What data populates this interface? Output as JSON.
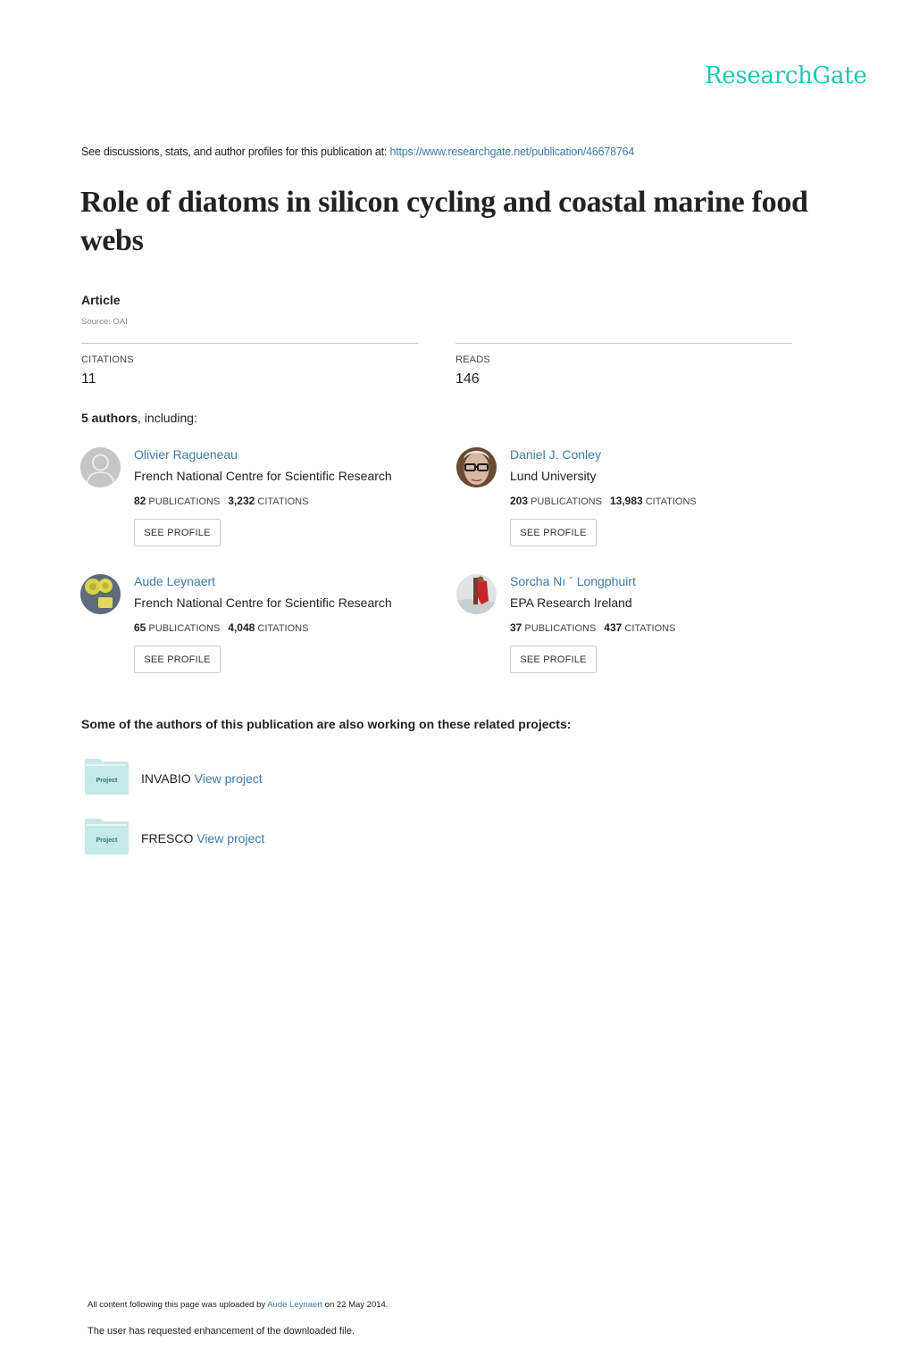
{
  "header": {
    "logo": "ResearchGate",
    "intro_text": "See discussions, stats, and author profiles for this publication at: ",
    "publication_url": "https://www.researchgate.net/publication/46678764"
  },
  "publication": {
    "title": "Role of diatoms in silicon cycling and coastal marine food webs",
    "type": "Article",
    "source": "Source: OAI"
  },
  "stats": {
    "citations_label": "CITATIONS",
    "citations_value": "11",
    "reads_label": "READS",
    "reads_value": "146"
  },
  "authors_summary": {
    "count_text": "5 authors",
    "suffix": ", including:"
  },
  "authors": [
    {
      "name": "Olivier Ragueneau",
      "institution": "French National Centre for Scientific Research",
      "publications": "82",
      "publications_label": "PUBLICATIONS",
      "citations": "3,232",
      "citations_label": "CITATIONS",
      "button": "SEE PROFILE",
      "avatar": "default-avatar"
    },
    {
      "name": "Daniel J. Conley",
      "institution": "Lund University",
      "publications": "203",
      "publications_label": "PUBLICATIONS",
      "citations": "13,983",
      "citations_label": "CITATIONS",
      "button": "SEE PROFILE",
      "avatar": "photo-man-glasses"
    },
    {
      "name": "Aude Leynaert",
      "institution": "French National Centre for Scientific Research",
      "publications": "65",
      "publications_label": "PUBLICATIONS",
      "citations": "4,048",
      "citations_label": "CITATIONS",
      "button": "SEE PROFILE",
      "avatar": "photo-diatoms"
    },
    {
      "name": "Sorcha Nı ´ Longphuirt",
      "institution": "EPA Research Ireland",
      "publications": "37",
      "publications_label": "PUBLICATIONS",
      "citations": "437",
      "citations_label": "CITATIONS",
      "button": "SEE PROFILE",
      "avatar": "photo-field-work"
    }
  ],
  "related": {
    "heading": "Some of the authors of this publication are also working on these related projects:",
    "projects": [
      {
        "icon_label": "Project",
        "name": "INVABIO",
        "link": "View project"
      },
      {
        "icon_label": "Project",
        "name": "FRESCO",
        "link": "View project"
      }
    ]
  },
  "footer": {
    "upload_prefix": "All content following this page was uploaded by ",
    "uploader": "Aude Leynaert",
    "upload_suffix": " on 22 May 2014.",
    "enhancement_note": "The user has requested enhancement of the downloaded file."
  },
  "colors": {
    "brand": "#1fc8b0",
    "link": "#3d7bab",
    "project_folder": "#c5e9e6"
  }
}
